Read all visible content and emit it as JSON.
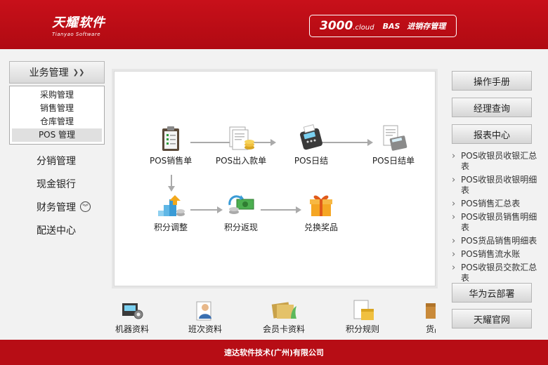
{
  "header": {
    "logo_cn": "天耀软件",
    "logo_en": "Tianyao Software",
    "product_name": "3000",
    "product_suffix": ".cloud",
    "product_tag": "BAS",
    "product_desc": "进销存管理"
  },
  "sidebar": {
    "section_title": "业务管理",
    "sub_items": [
      {
        "label": "采购管理"
      },
      {
        "label": "销售管理"
      },
      {
        "label": "仓库管理"
      },
      {
        "label": "POS 管理"
      }
    ],
    "items": [
      {
        "label": "分销管理"
      },
      {
        "label": "现金银行"
      },
      {
        "label": "财务管理"
      },
      {
        "label": "配送中心"
      }
    ]
  },
  "flow": {
    "items": [
      {
        "label": "POS销售单",
        "icon": "clipboard-icon"
      },
      {
        "label": "POS出入款单",
        "icon": "documents-coins-icon"
      },
      {
        "label": "POS日结",
        "icon": "pos-terminal-icon"
      },
      {
        "label": "POS日结单",
        "icon": "receipt-calculator-icon"
      },
      {
        "label": "积分调整",
        "icon": "stairs-coins-icon"
      },
      {
        "label": "积分返现",
        "icon": "cash-return-icon"
      },
      {
        "label": "兑换奖品",
        "icon": "gift-icon"
      }
    ]
  },
  "bottom": {
    "items": [
      {
        "label": "机器资料",
        "icon": "machine-gear-icon"
      },
      {
        "label": "班次资料",
        "icon": "staff-person-icon"
      },
      {
        "label": "会员卡资料",
        "icon": "member-card-icon"
      },
      {
        "label": "积分规则",
        "icon": "rules-box-icon"
      },
      {
        "label": "货品",
        "icon": "goods-box-icon"
      }
    ]
  },
  "right": {
    "manual": "操作手册",
    "manager_query": "经理查询",
    "report_center": "报表中心",
    "reports": [
      {
        "label": "POS收银员收银汇总表"
      },
      {
        "label": "POS收银员收银明细表"
      },
      {
        "label": "POS销售汇总表"
      },
      {
        "label": "POS收银员销售明细表"
      },
      {
        "label": "POS货品销售明细表"
      },
      {
        "label": "POS销售流水账"
      },
      {
        "label": "POS收银员交款汇总表"
      }
    ],
    "huawei": "华为云部署",
    "official": "天耀官网"
  },
  "footer": {
    "company": "速达软件技术(广州)有限公司"
  },
  "colors": {
    "brand_red": "#c8101a",
    "footer_red": "#b70d15"
  }
}
